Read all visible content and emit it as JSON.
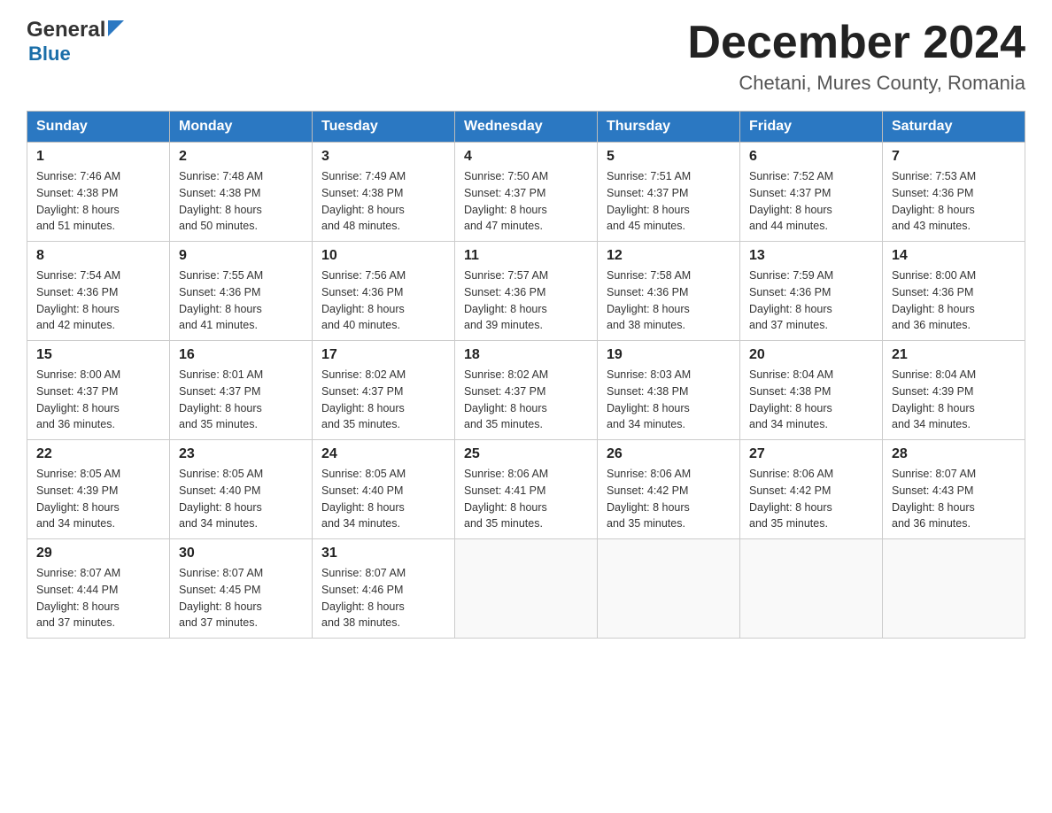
{
  "header": {
    "title": "December 2024",
    "subtitle": "Chetani, Mures County, Romania"
  },
  "logo": {
    "line1_black": "General",
    "line2_blue": "Blue"
  },
  "weekdays": [
    "Sunday",
    "Monday",
    "Tuesday",
    "Wednesday",
    "Thursday",
    "Friday",
    "Saturday"
  ],
  "weeks": [
    [
      {
        "day": "1",
        "sunrise": "7:46 AM",
        "sunset": "4:38 PM",
        "daylight": "8 hours and 51 minutes."
      },
      {
        "day": "2",
        "sunrise": "7:48 AM",
        "sunset": "4:38 PM",
        "daylight": "8 hours and 50 minutes."
      },
      {
        "day": "3",
        "sunrise": "7:49 AM",
        "sunset": "4:38 PM",
        "daylight": "8 hours and 48 minutes."
      },
      {
        "day": "4",
        "sunrise": "7:50 AM",
        "sunset": "4:37 PM",
        "daylight": "8 hours and 47 minutes."
      },
      {
        "day": "5",
        "sunrise": "7:51 AM",
        "sunset": "4:37 PM",
        "daylight": "8 hours and 45 minutes."
      },
      {
        "day": "6",
        "sunrise": "7:52 AM",
        "sunset": "4:37 PM",
        "daylight": "8 hours and 44 minutes."
      },
      {
        "day": "7",
        "sunrise": "7:53 AM",
        "sunset": "4:36 PM",
        "daylight": "8 hours and 43 minutes."
      }
    ],
    [
      {
        "day": "8",
        "sunrise": "7:54 AM",
        "sunset": "4:36 PM",
        "daylight": "8 hours and 42 minutes."
      },
      {
        "day": "9",
        "sunrise": "7:55 AM",
        "sunset": "4:36 PM",
        "daylight": "8 hours and 41 minutes."
      },
      {
        "day": "10",
        "sunrise": "7:56 AM",
        "sunset": "4:36 PM",
        "daylight": "8 hours and 40 minutes."
      },
      {
        "day": "11",
        "sunrise": "7:57 AM",
        "sunset": "4:36 PM",
        "daylight": "8 hours and 39 minutes."
      },
      {
        "day": "12",
        "sunrise": "7:58 AM",
        "sunset": "4:36 PM",
        "daylight": "8 hours and 38 minutes."
      },
      {
        "day": "13",
        "sunrise": "7:59 AM",
        "sunset": "4:36 PM",
        "daylight": "8 hours and 37 minutes."
      },
      {
        "day": "14",
        "sunrise": "8:00 AM",
        "sunset": "4:36 PM",
        "daylight": "8 hours and 36 minutes."
      }
    ],
    [
      {
        "day": "15",
        "sunrise": "8:00 AM",
        "sunset": "4:37 PM",
        "daylight": "8 hours and 36 minutes."
      },
      {
        "day": "16",
        "sunrise": "8:01 AM",
        "sunset": "4:37 PM",
        "daylight": "8 hours and 35 minutes."
      },
      {
        "day": "17",
        "sunrise": "8:02 AM",
        "sunset": "4:37 PM",
        "daylight": "8 hours and 35 minutes."
      },
      {
        "day": "18",
        "sunrise": "8:02 AM",
        "sunset": "4:37 PM",
        "daylight": "8 hours and 35 minutes."
      },
      {
        "day": "19",
        "sunrise": "8:03 AM",
        "sunset": "4:38 PM",
        "daylight": "8 hours and 34 minutes."
      },
      {
        "day": "20",
        "sunrise": "8:04 AM",
        "sunset": "4:38 PM",
        "daylight": "8 hours and 34 minutes."
      },
      {
        "day": "21",
        "sunrise": "8:04 AM",
        "sunset": "4:39 PM",
        "daylight": "8 hours and 34 minutes."
      }
    ],
    [
      {
        "day": "22",
        "sunrise": "8:05 AM",
        "sunset": "4:39 PM",
        "daylight": "8 hours and 34 minutes."
      },
      {
        "day": "23",
        "sunrise": "8:05 AM",
        "sunset": "4:40 PM",
        "daylight": "8 hours and 34 minutes."
      },
      {
        "day": "24",
        "sunrise": "8:05 AM",
        "sunset": "4:40 PM",
        "daylight": "8 hours and 34 minutes."
      },
      {
        "day": "25",
        "sunrise": "8:06 AM",
        "sunset": "4:41 PM",
        "daylight": "8 hours and 35 minutes."
      },
      {
        "day": "26",
        "sunrise": "8:06 AM",
        "sunset": "4:42 PM",
        "daylight": "8 hours and 35 minutes."
      },
      {
        "day": "27",
        "sunrise": "8:06 AM",
        "sunset": "4:42 PM",
        "daylight": "8 hours and 35 minutes."
      },
      {
        "day": "28",
        "sunrise": "8:07 AM",
        "sunset": "4:43 PM",
        "daylight": "8 hours and 36 minutes."
      }
    ],
    [
      {
        "day": "29",
        "sunrise": "8:07 AM",
        "sunset": "4:44 PM",
        "daylight": "8 hours and 37 minutes."
      },
      {
        "day": "30",
        "sunrise": "8:07 AM",
        "sunset": "4:45 PM",
        "daylight": "8 hours and 37 minutes."
      },
      {
        "day": "31",
        "sunrise": "8:07 AM",
        "sunset": "4:46 PM",
        "daylight": "8 hours and 38 minutes."
      },
      null,
      null,
      null,
      null
    ]
  ],
  "labels": {
    "sunrise": "Sunrise:",
    "sunset": "Sunset:",
    "daylight": "Daylight:"
  }
}
